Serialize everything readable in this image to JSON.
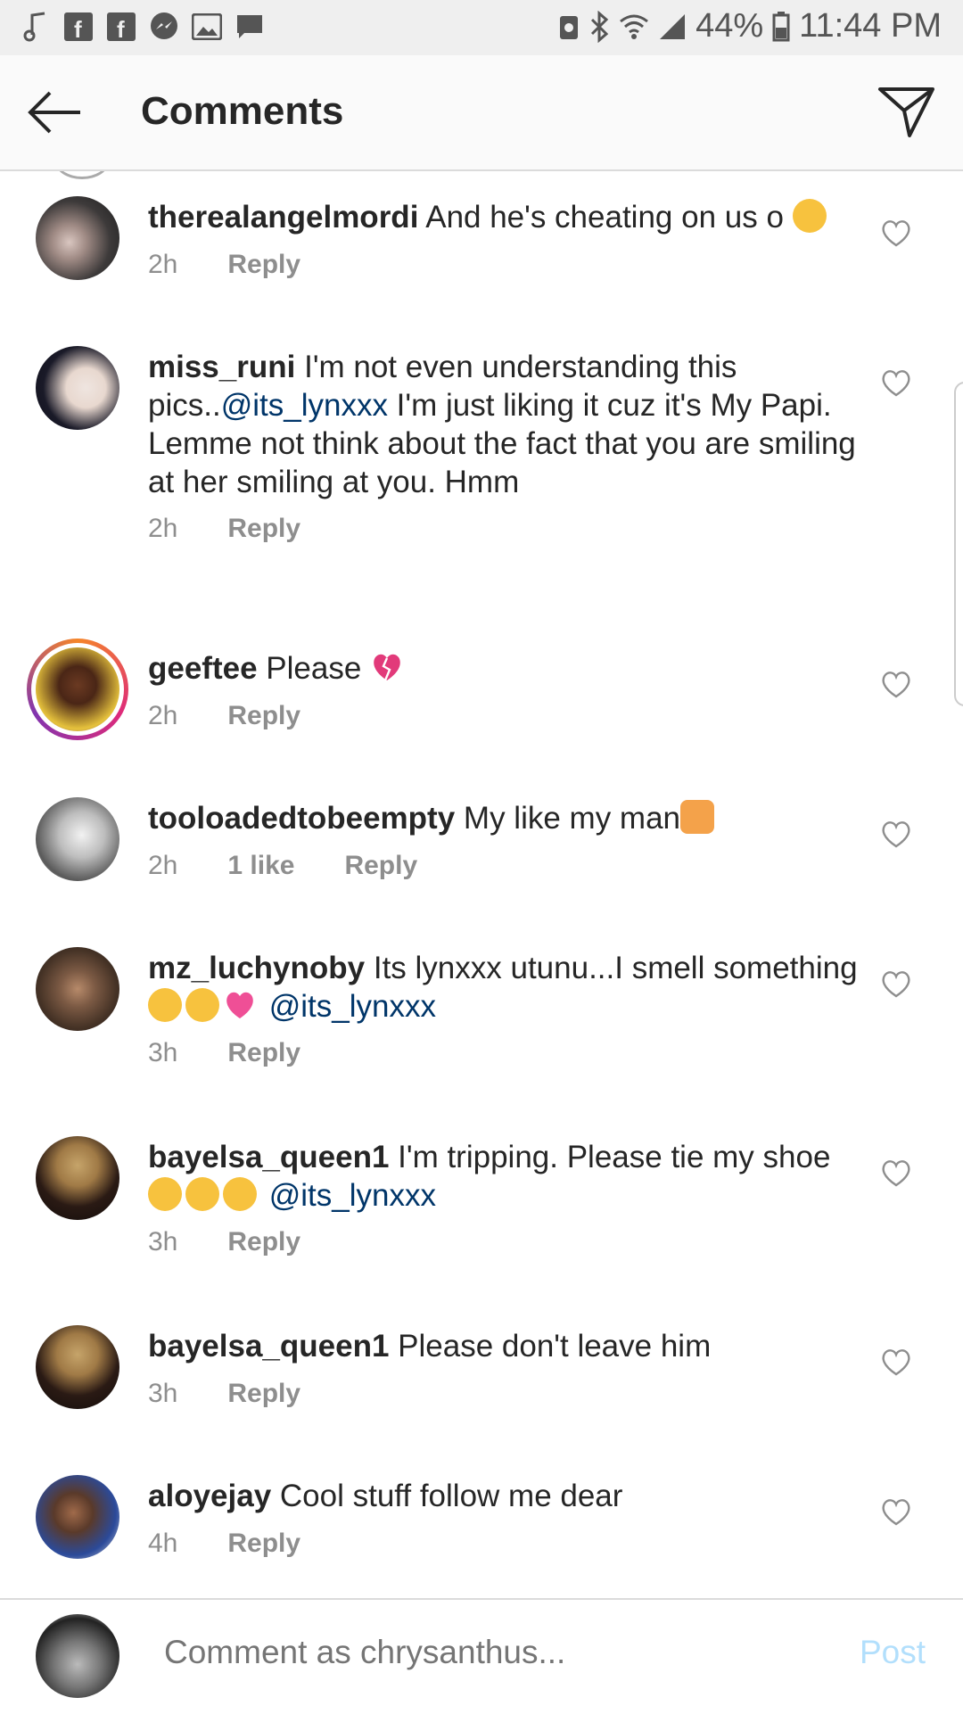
{
  "status_bar": {
    "battery": "44%",
    "time": "11:44 PM"
  },
  "header": {
    "title": "Comments"
  },
  "comments": [
    {
      "user": "therealangelmordi",
      "text": "And he's cheating on us o",
      "time": "2h",
      "reply": "Reply",
      "emoji": [
        "cry"
      ]
    },
    {
      "user": "miss_runi",
      "text_a": "I'm not even understanding this pics..",
      "mention": "@its_lynxxx",
      "text_b": " I'm just liking it cuz it's My Papi. Lemme not think about the fact that you are smiling at her smiling at you. Hmm",
      "time": "2h",
      "reply": "Reply"
    },
    {
      "user": "geeftee",
      "text": "Please",
      "time": "2h",
      "reply": "Reply",
      "emoji": [
        "broken-heart"
      ]
    },
    {
      "user": "tooloadedtobeempty",
      "text": "My like my man",
      "time": "2h",
      "likes": "1 like",
      "reply": "Reply",
      "emoji": [
        "raising-hands-person"
      ]
    },
    {
      "user": "mz_luchynoby",
      "text": "Its lynxxx utunu...I smell something",
      "mention": "@its_lynxxx",
      "time": "3h",
      "reply": "Reply",
      "emoji": [
        "unamused",
        "blush",
        "sparkling-heart"
      ]
    },
    {
      "user": "bayelsa_queen1",
      "text": "I'm tripping. Please tie my shoe",
      "mention": "@its_lynxxx",
      "time": "3h",
      "reply": "Reply",
      "emoji": [
        "heart-eyes",
        "heart-eyes",
        "heart-eyes"
      ]
    },
    {
      "user": "bayelsa_queen1",
      "text": "Please don't leave him",
      "time": "3h",
      "reply": "Reply"
    },
    {
      "user": "aloyejay",
      "text": "Cool stuff follow me dear",
      "time": "4h",
      "reply": "Reply"
    }
  ],
  "composer": {
    "placeholder": "Comment as chrysanthus...",
    "post_label": "Post"
  },
  "colors": {
    "mention": "#003569",
    "meta": "#8e8e8e",
    "post": "#b2dffc"
  }
}
